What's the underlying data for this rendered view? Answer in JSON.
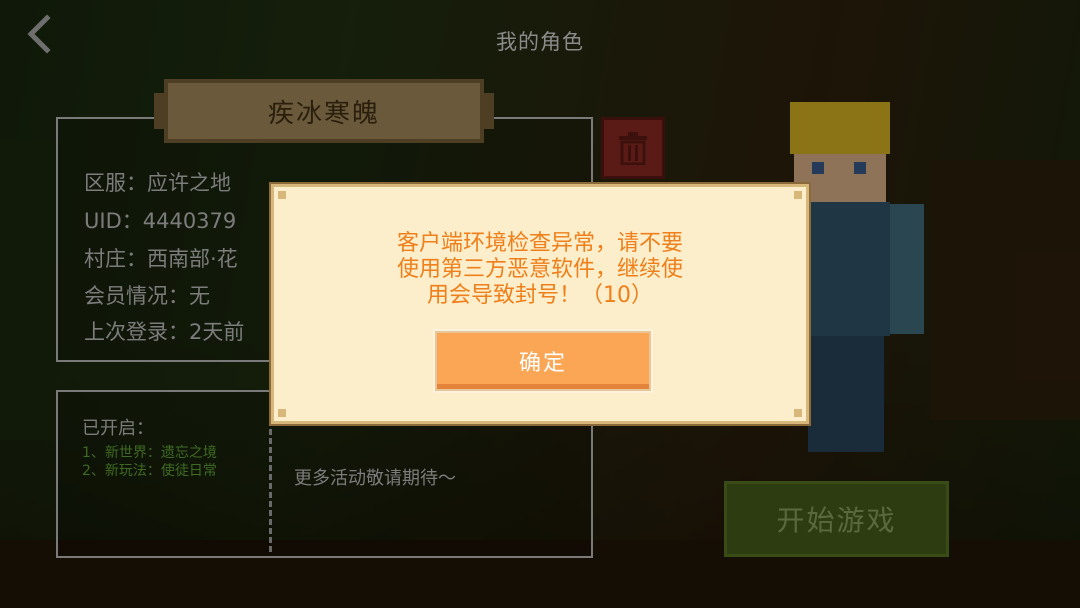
{
  "header": {
    "title": "我的角色"
  },
  "role": {
    "name": "疾冰寒魄",
    "info": [
      "区服：应许之地",
      "UID：4440379",
      "村庄：西南部·花",
      "会员情况：无",
      "上次登录：2天前"
    ]
  },
  "activities": {
    "heading": "已开启：",
    "items": [
      "1、新世界：遗忘之境",
      "2、新玩法：使徒日常"
    ],
    "more": "更多活动敬请期待～"
  },
  "start_button": {
    "label": "开始游戏"
  },
  "dialog": {
    "message_lines": [
      "客户端环境检查异常，请不要",
      "使用第三方恶意软件，继续使",
      "用会导致封号！（10）"
    ],
    "confirm_label": "确定"
  },
  "colors": {
    "dialog_bg": "#fdeecb",
    "dialog_text": "#ee7f1a",
    "confirm_button": "#fba655",
    "delete_button": "#5a1a16",
    "start_button": "#2e3c12"
  },
  "icons": {
    "back": "chevron-left-icon",
    "delete": "trash-icon"
  }
}
